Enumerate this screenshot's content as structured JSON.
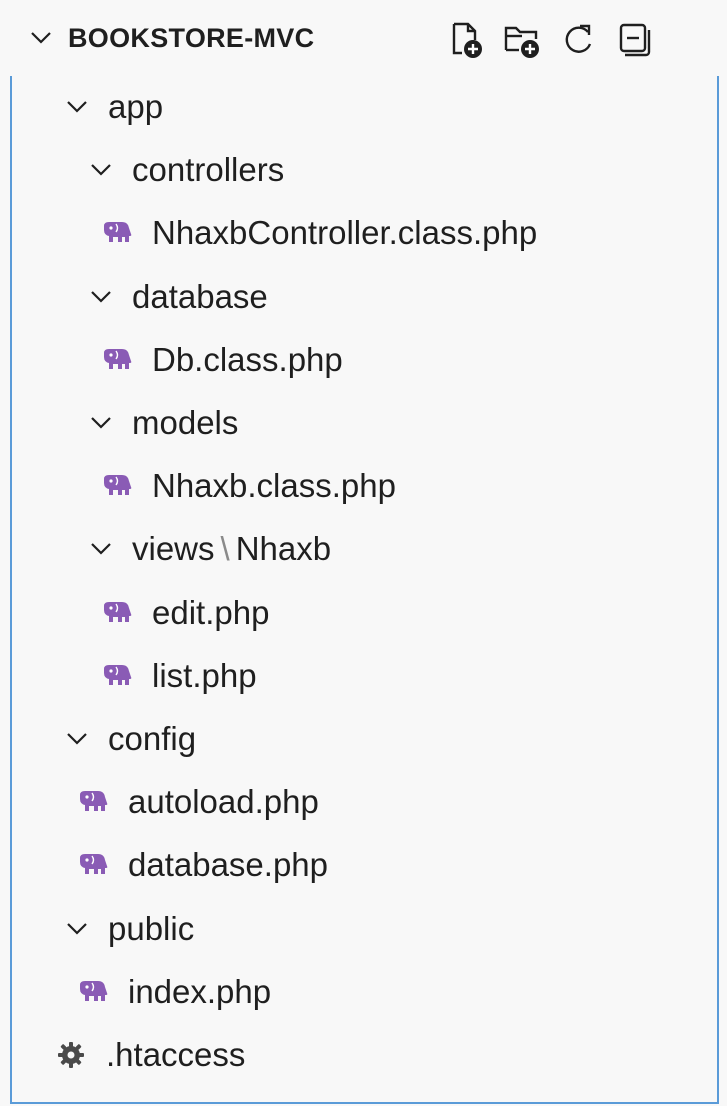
{
  "explorer": {
    "title": "BOOKSTORE-MVC",
    "actions": [
      {
        "name": "new-file-button",
        "icon": "new-file-icon"
      },
      {
        "name": "new-folder-button",
        "icon": "new-folder-icon"
      },
      {
        "name": "refresh-button",
        "icon": "refresh-icon"
      },
      {
        "name": "collapse-all-button",
        "icon": "collapse-all-icon"
      }
    ]
  },
  "tree": [
    {
      "type": "folder",
      "label": "app"
    },
    {
      "type": "folder",
      "label": "controllers"
    },
    {
      "type": "file",
      "label": "NhaxbController.class.php"
    },
    {
      "type": "folder",
      "label": "database"
    },
    {
      "type": "file",
      "label": "Db.class.php"
    },
    {
      "type": "folder",
      "label": "models"
    },
    {
      "type": "file",
      "label": "Nhaxb.class.php"
    },
    {
      "type": "folder",
      "label": "views",
      "sublabel": "Nhaxb"
    },
    {
      "type": "file",
      "label": "edit.php"
    },
    {
      "type": "file",
      "label": "list.php"
    },
    {
      "type": "folder",
      "label": "config"
    },
    {
      "type": "file",
      "label": "autoload.php"
    },
    {
      "type": "file",
      "label": "database.php"
    },
    {
      "type": "folder",
      "label": "public"
    },
    {
      "type": "file",
      "label": "index.php"
    },
    {
      "type": "settings",
      "label": ".htaccess"
    }
  ],
  "colors": {
    "php_icon": "#8a5bb5",
    "accent_border": "#5a9bd8",
    "text": "#1f1f1f"
  }
}
